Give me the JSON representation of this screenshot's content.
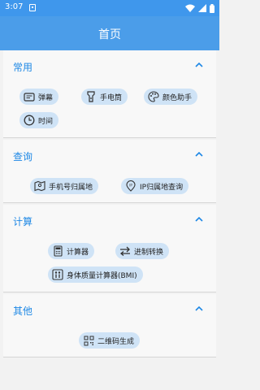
{
  "status": {
    "time": "3:07"
  },
  "appbar": {
    "title": "首页"
  },
  "sections": [
    {
      "title": "常用",
      "items": [
        {
          "label": "弹幕",
          "icon": "danmaku-icon"
        },
        {
          "label": "手电筒",
          "icon": "flashlight-icon"
        },
        {
          "label": "颜色助手",
          "icon": "palette-icon"
        },
        {
          "label": "时间",
          "icon": "clock-icon"
        }
      ]
    },
    {
      "title": "查询",
      "items": [
        {
          "label": "手机号归属地",
          "icon": "map-icon"
        },
        {
          "label": "IP归属地查询",
          "icon": "location-pin-icon"
        }
      ]
    },
    {
      "title": "计算",
      "items": [
        {
          "label": "计算器",
          "icon": "calculator-icon"
        },
        {
          "label": "进制转换",
          "icon": "swap-arrows-icon"
        },
        {
          "label": "身体质量计算器(BMI)",
          "icon": "people-icon"
        }
      ]
    },
    {
      "title": "其他",
      "items": [
        {
          "label": "二维码生成",
          "icon": "qr-code-icon"
        }
      ]
    }
  ],
  "colors": {
    "statusbar": "#3f97ec",
    "appbar": "#4b9de9",
    "accent": "#1e88e5",
    "chip": "#cfe3f6"
  }
}
